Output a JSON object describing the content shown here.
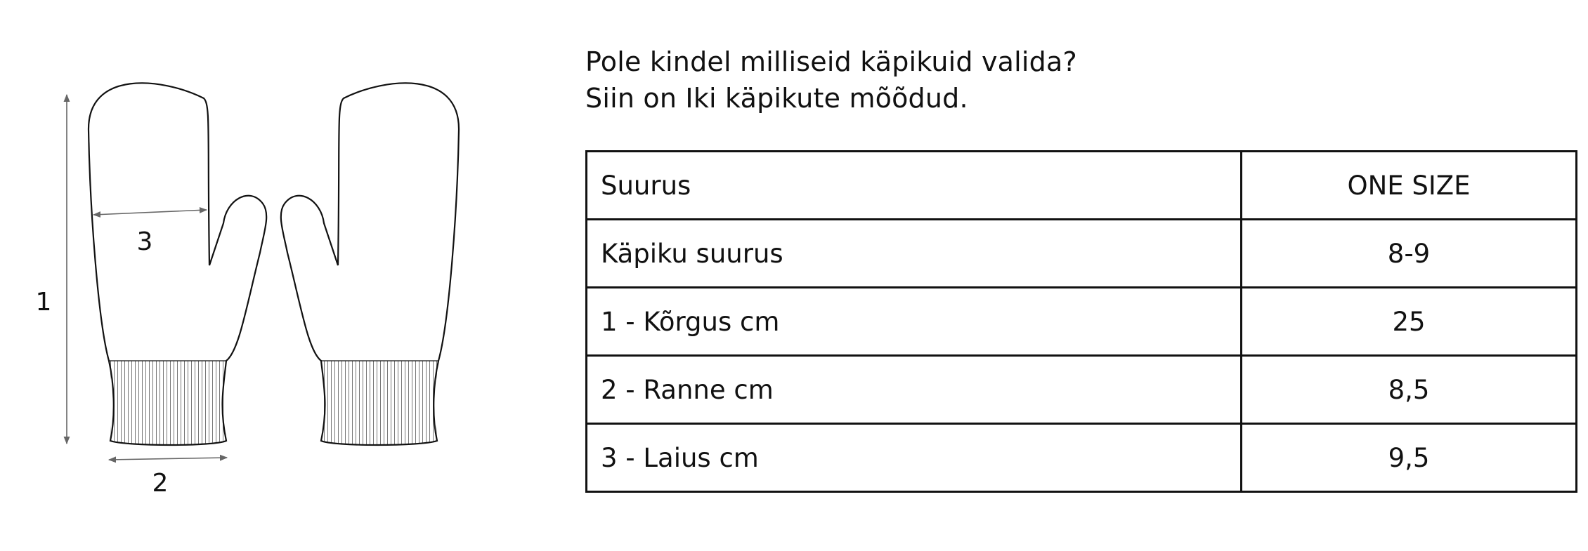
{
  "diagram": {
    "labels": {
      "height": "1",
      "wrist": "2",
      "width": "3"
    }
  },
  "heading": {
    "line1": "Pole kindel milliseid käpikuid valida?",
    "line2": "Siin on Iki käpikute mõõdud."
  },
  "table": {
    "rows": [
      {
        "label": "Suurus",
        "value": "ONE SIZE"
      },
      {
        "label": "Käpiku suurus",
        "value": "8-9"
      },
      {
        "label": "1 - Kõrgus cm",
        "value": "25"
      },
      {
        "label": "2 - Ranne cm",
        "value": "8,5"
      },
      {
        "label": "3 - Laius cm",
        "value": "9,5"
      }
    ]
  }
}
